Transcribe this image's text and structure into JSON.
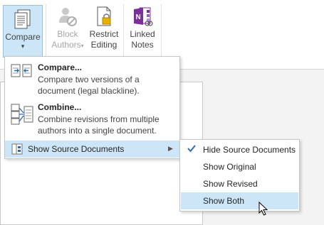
{
  "ribbon": {
    "compare": {
      "line1": "Compare",
      "arrow": "▾"
    },
    "block": {
      "line1": "Block",
      "line2": "Authors",
      "arrow": "▾"
    },
    "restrict": {
      "line1": "Restrict",
      "line2": "Editing"
    },
    "linked": {
      "line1": "Linked",
      "line2": "Notes"
    }
  },
  "menu": {
    "compare": {
      "title": "Compare...",
      "desc": "Compare two versions of a document (legal blackline)."
    },
    "combine": {
      "title": "Combine...",
      "desc": "Combine revisions from multiple authors into a single document."
    },
    "show_source": {
      "label": "Show Source Documents",
      "arrow": "▶"
    }
  },
  "submenu": {
    "items": [
      {
        "label": "Hide Source Documents",
        "checked": true
      },
      {
        "label": "Show Original",
        "checked": false
      },
      {
        "label": "Show Revised",
        "checked": false
      },
      {
        "label": "Show Both",
        "checked": false,
        "highlighted": true
      }
    ]
  },
  "colors": {
    "highlight": "#cde6f7",
    "onenote": "#7b2f9a",
    "accent_blue": "#2b6cb0"
  }
}
